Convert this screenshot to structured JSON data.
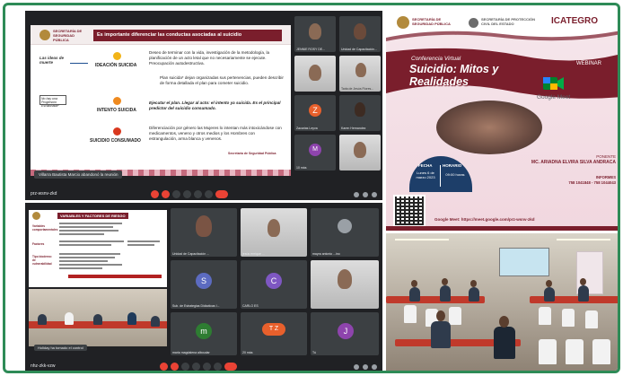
{
  "meet1": {
    "slide": {
      "org_name": "SECRETARÍA DE SEGURIDAD PÚBLICA",
      "title": "Es importante diferenciar las conductas asociadas al suicidio",
      "left_label": "Las ideas de muerte",
      "left_box": "No hay una Progresión Escalonada*",
      "stages": [
        "IDEACIÓN SUICIDA",
        "INTENTO SUICIDA",
        "SUICIDIO CONSUMADO"
      ],
      "para1": "Deseo de terminar con la vida, investigación de la metodología, la planificación de un acto letal que no necesariamente se ejecute. Preocupación autodestructiva.",
      "para2": "Plan suicida* dejan organizadas sus pertenencias, pueden describir de forma detallada el plan para cometer suicidio.",
      "para3": "Ejecutar el plan. Llegar al acto: el intento ya suicida. Es el principal predictor del suicidio consumado.",
      "para4": "Diferenciación por género las Mujeres lo intentan más intoxicándose con medicamentos, veneno y otros medios y los Hombres con estrangulación, arma blanca y venenos.",
      "footer_org": "Secretaría de Seguridad Pública"
    },
    "notice": "Villarra Bautista Marcio abandonó la reunión",
    "meeting_code": "prz-wsnv-zkd",
    "participants": [
      {
        "name": "JENNIE ROSY DE..."
      },
      {
        "name": "Unidad de Capacitación..."
      },
      {
        "name": ""
      },
      {
        "name": "Tarla de Jesús Flores..."
      },
      {
        "name": "Zacarias Leyva",
        "initial": "Z"
      },
      {
        "name": "Karen Hernandez"
      },
      {
        "name": "10 más",
        "initial": "M"
      },
      {
        "name": ""
      }
    ]
  },
  "meet2": {
    "slide": {
      "title": "VARIABLES Y FACTORES DE RIESGO",
      "labels": [
        "Variables comportamentales",
        "Factores",
        "Tipo biodemo: de vulnerabilidad"
      ],
      "footer": ""
    },
    "notice": "Holiday ha tomado el control",
    "meeting_code": "nhz-zkk-vzw",
    "participants": [
      {
        "name": "Unidad de Capacitación ..."
      },
      {
        "name": "jesús enrique ..."
      },
      {
        "name": "mayra antonio ...ino"
      },
      {
        "name": "Sub. de Estrategias Didácticas I...",
        "initial": "S"
      },
      {
        "name": "CARLO ES",
        "initial": "C"
      },
      {
        "name": ""
      },
      {
        "name": "maria magdalena alboudar",
        "initial": "m"
      },
      {
        "name": "20 más",
        "initial": "T Z"
      },
      {
        "name": "Tú",
        "initial": "J"
      }
    ]
  },
  "poster": {
    "org1": "SECRETARÍA DE SEGURIDAD PÚBLICA",
    "org2": "SECRETARÍA DE PROTECCIÓN CIVIL DEL ESTADO",
    "org3": "ICATEGRO",
    "webinar": "WEBINAR",
    "subtitle": "Conferencia Virtual",
    "title": "Suicidio: Mitos y Realidades",
    "platform": "Google Meet",
    "fecha_label": "FECHA",
    "fecha_value": "Lunes 6 de marzo 2023",
    "horario_label": "HORARIO",
    "horario_value": "09:00 horas",
    "ponente_label": "PONENTE",
    "ponente_name": "MC. ARIADNA ELVIRA SILVA ANDRACA",
    "informes_label": "INFORMES",
    "informes_value": "758 1041848 - 758 1044043",
    "link": "Google Meet: https://meet.google.com/prz-wsnv-zkd"
  },
  "colors": {
    "meet_bg": "#202124",
    "tile_bg": "#3c4043",
    "guinda": "#7a1e2c",
    "end_call": "#ea4335",
    "frame": "#2e8b57"
  }
}
